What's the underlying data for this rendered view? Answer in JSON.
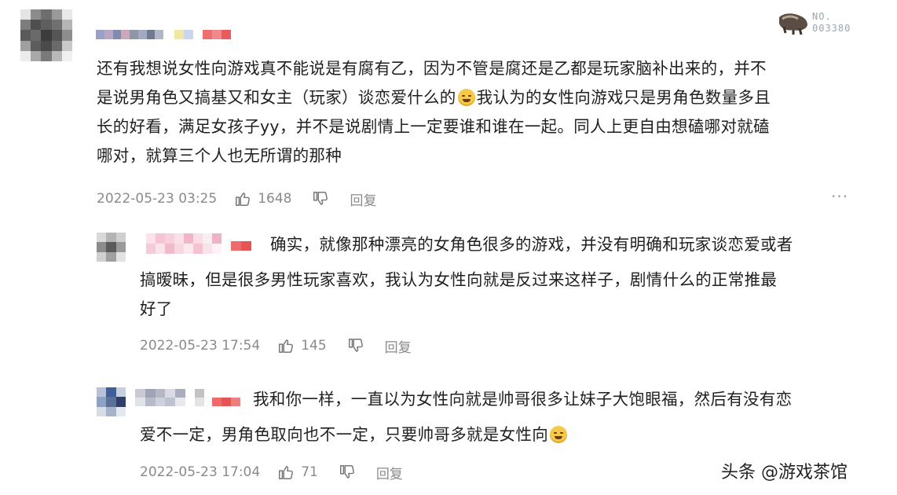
{
  "badge": {
    "no_label": "NO.",
    "number": "003380"
  },
  "comments": [
    {
      "text_lines": [
        "还有我想说女性向游戏真不能说是有腐有乙，因为不管是腐还是乙都是玩家脑补出来的，并不",
        "是说男角色又搞基又和女主（玩家）谈恋爱什么的",
        "我认为的女性向游戏只是男角色数量多且",
        "长的好看，满足女孩子yy，并不是说剧情上一定要谁和谁在一起。同人上更自由想磕哪对就磕",
        "哪对，就算三个人也无所谓的那种"
      ],
      "time": "2022-05-23 03:25",
      "likes": "1648",
      "reply": "回复",
      "more": "···"
    },
    {
      "text_lines": [
        "确实，就像那种漂亮的女角色很多的游戏，并没有明确和玩家谈恋爱或者",
        "搞暧昧，但是很多男性玩家喜欢，我认为女性向就是反过来这样子，剧情什么的正常推最",
        "好了"
      ],
      "time": "2022-05-23 17:54",
      "likes": "145",
      "reply": "回复"
    },
    {
      "text_lines": [
        "我和你一样，一直以为女性向就是帅哥很多让妹子大饱眼福，然后有没有恋",
        "爱不一定，男角色取向也不一定，只要帅哥多就是女性向"
      ],
      "time": "2022-05-23 17:04",
      "likes": "71",
      "reply": "回复"
    }
  ],
  "watermark": "头条 @游戏茶馆",
  "colors": {
    "text": "#1f1f1f",
    "meta": "#8a8a8a",
    "emoji": "#f7c948"
  }
}
